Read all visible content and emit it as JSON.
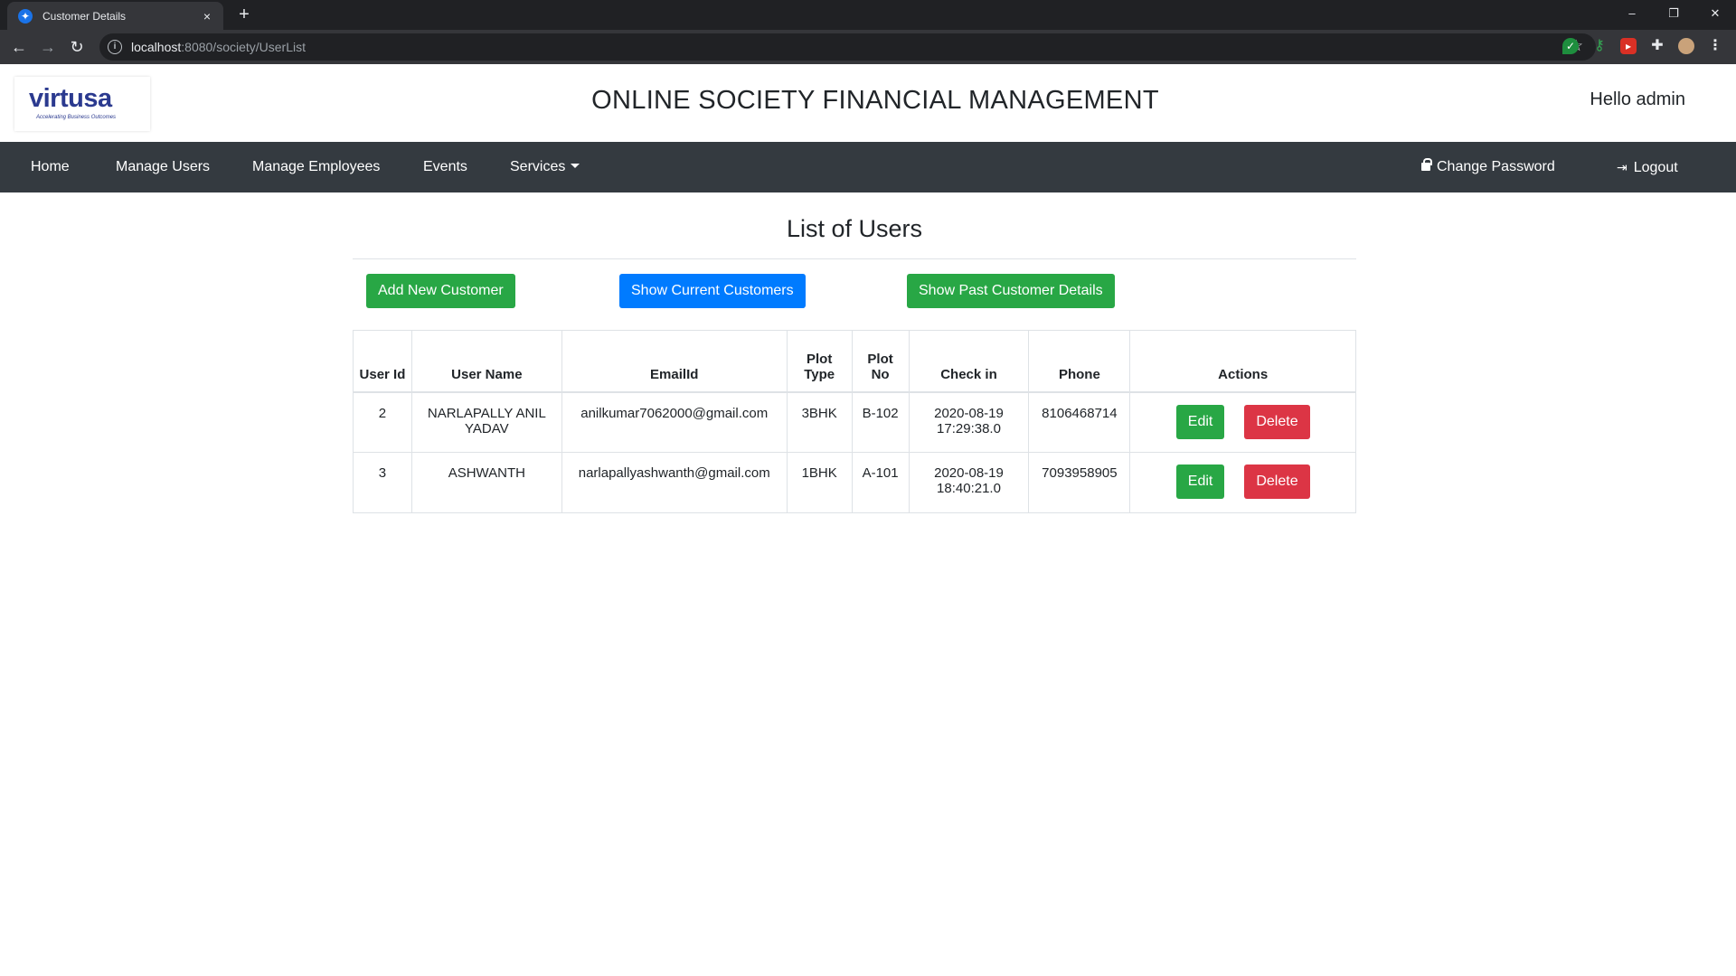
{
  "browser": {
    "tab_title": "Customer Details",
    "tab_close": "×",
    "new_tab": "+",
    "url_host": "localhost",
    "url_rest": ":8080/society/UserList",
    "win_minimize": "–",
    "win_restore": "❐",
    "win_close": "✕"
  },
  "header": {
    "logo_text": "virtusa",
    "logo_tagline": "Accelerating Business Outcomes",
    "title": "ONLINE SOCIETY FINANCIAL MANAGEMENT",
    "greeting": "Hello admin"
  },
  "nav": {
    "home": "Home",
    "manage_users": "Manage Users",
    "manage_employees": "Manage Employees",
    "events": "Events",
    "services": "Services",
    "change_password": "Change Password",
    "logout": "Logout"
  },
  "main": {
    "heading": "List of Users",
    "add_button": "Add New Customer",
    "current_button": "Show Current Customers",
    "past_button": "Show Past Customer Details"
  },
  "table": {
    "headers": {
      "user_id": "User Id",
      "user_name": "User Name",
      "email": "EmailId",
      "plot_type": "Plot Type",
      "plot_no": "Plot No",
      "check_in": "Check in",
      "phone": "Phone",
      "actions": "Actions"
    },
    "rows": [
      {
        "user_id": "2",
        "user_name": "NARLAPALLY ANIL YADAV",
        "email": "anilkumar7062000@gmail.com",
        "plot_type": "3BHK",
        "plot_no": "B-102",
        "check_in": "2020-08-19 17:29:38.0",
        "phone": "8106468714",
        "edit": "Edit",
        "delete": "Delete"
      },
      {
        "user_id": "3",
        "user_name": "ASHWANTH",
        "email": "narlapallyashwanth@gmail.com",
        "plot_type": "1BHK",
        "plot_no": "A-101",
        "check_in": "2020-08-19 18:40:21.0",
        "phone": "7093958905",
        "edit": "Edit",
        "delete": "Delete"
      }
    ]
  },
  "colors": {
    "navbar": "#343a40",
    "success": "#28a745",
    "primary": "#007bff",
    "danger": "#dc3545"
  }
}
